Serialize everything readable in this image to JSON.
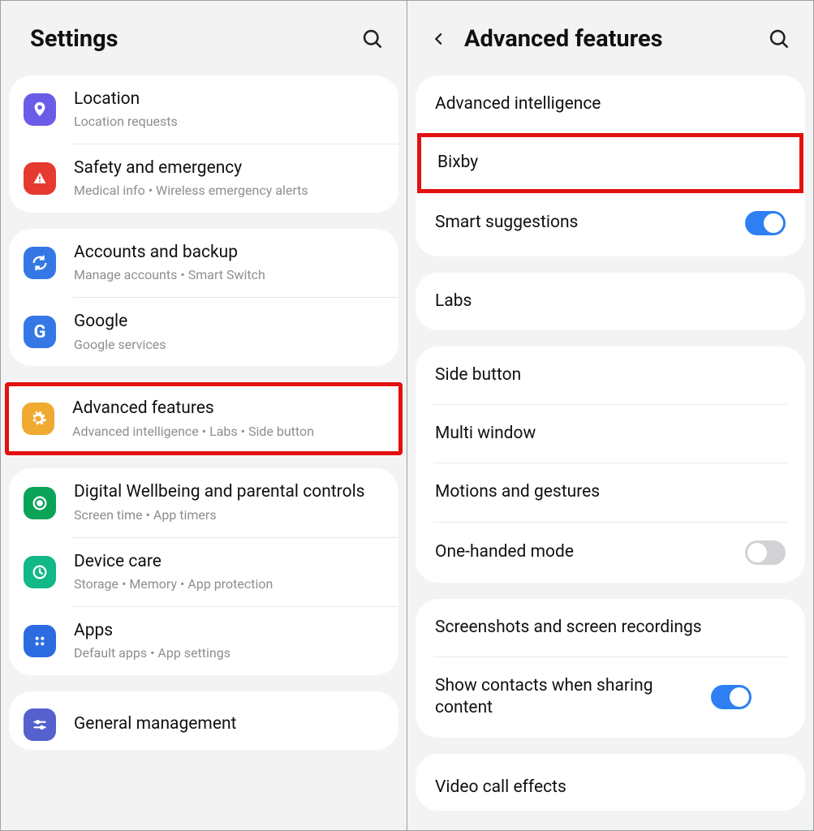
{
  "left": {
    "title": "Settings",
    "groups": [
      {
        "items": [
          {
            "icon": "location-icon",
            "icon_bg": "ic-purple",
            "title": "Location",
            "sub": "Location requests"
          },
          {
            "icon": "emergency-icon",
            "icon_bg": "ic-red",
            "title": "Safety and emergency",
            "sub": "Medical info  •  Wireless emergency alerts"
          }
        ]
      },
      {
        "items": [
          {
            "icon": "sync-icon",
            "icon_bg": "ic-blue",
            "title": "Accounts and backup",
            "sub": "Manage accounts  •  Smart Switch"
          },
          {
            "icon": "google-icon",
            "icon_bg": "ic-gblue",
            "title": "Google",
            "sub": "Google services"
          }
        ]
      }
    ],
    "highlighted": {
      "icon": "gear-icon",
      "icon_bg": "ic-orange",
      "title": "Advanced features",
      "sub": "Advanced intelligence  •  Labs  •  Side button"
    },
    "group3": {
      "items": [
        {
          "icon": "wellbeing-icon",
          "icon_bg": "ic-green",
          "title": "Digital Wellbeing and parental controls",
          "sub": "Screen time  •  App timers"
        },
        {
          "icon": "device-care-icon",
          "icon_bg": "ic-teal",
          "title": "Device care",
          "sub": "Storage  •  Memory  •  App protection"
        },
        {
          "icon": "apps-icon",
          "icon_bg": "ic-dblue",
          "title": "Apps",
          "sub": "Default apps  •  App settings"
        }
      ]
    },
    "group4": {
      "items": [
        {
          "icon": "sliders-icon",
          "icon_bg": "ic-indigo",
          "title": "General management",
          "sub": ""
        }
      ]
    }
  },
  "right": {
    "title": "Advanced features",
    "cards": [
      {
        "items": [
          {
            "label": "Advanced intelligence",
            "toggle": null,
            "highlight": false
          },
          {
            "label": "Bixby",
            "toggle": null,
            "highlight": true
          },
          {
            "label": "Smart suggestions",
            "toggle": "on",
            "highlight": false
          }
        ]
      },
      {
        "items": [
          {
            "label": "Labs",
            "toggle": null,
            "highlight": false
          }
        ]
      },
      {
        "items": [
          {
            "label": "Side button",
            "toggle": null,
            "highlight": false
          },
          {
            "label": "Multi window",
            "toggle": null,
            "highlight": false
          },
          {
            "label": "Motions and gestures",
            "toggle": null,
            "highlight": false
          },
          {
            "label": "One-handed mode",
            "toggle": "off",
            "highlight": false
          }
        ]
      },
      {
        "items": [
          {
            "label": "Screenshots and screen recordings",
            "toggle": null,
            "highlight": false
          },
          {
            "label": "Show contacts when sharing content",
            "toggle": "on",
            "highlight": false
          }
        ]
      },
      {
        "items": [
          {
            "label": "Video call effects",
            "toggle": null,
            "highlight": false
          }
        ]
      }
    ]
  }
}
